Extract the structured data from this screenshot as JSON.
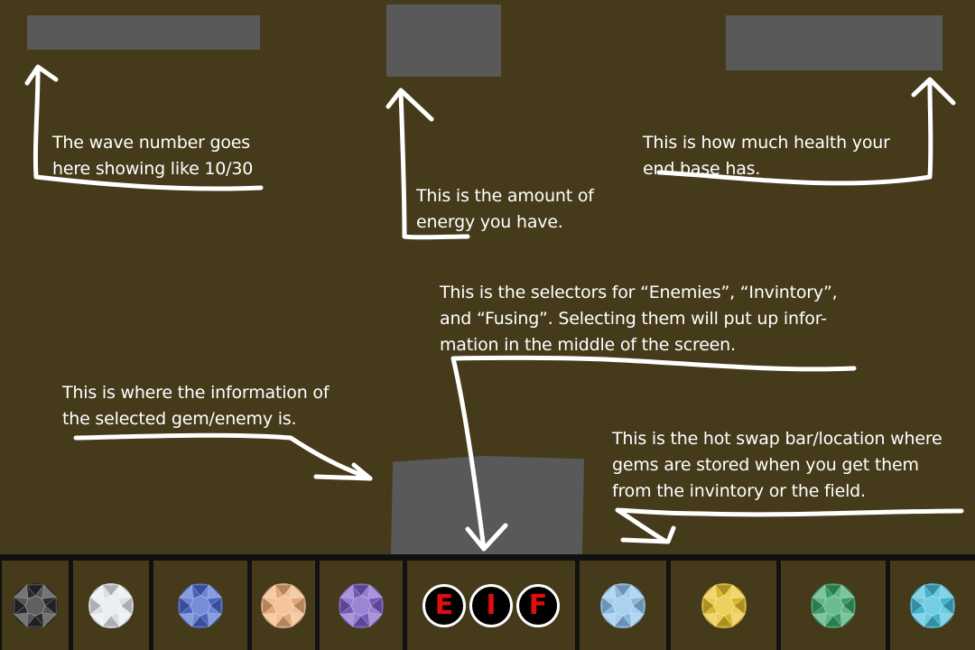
{
  "annotations": {
    "wave": "The wave number goes\nhere showing like 10/30",
    "energy": "This is the amount of\nenergy you have.",
    "health": "This is how much health your\nend base has.",
    "selectors": "This is the selectors for “Enemies”, “Invintory”,\nand “Fusing”. Selecting them will put up infor-\nmation in the middle of the screen.",
    "info": "This is where the information of\nthe selected gem/enemy is.",
    "hotswap": "This is the hot swap bar/location where\ngems are stored when you get them\nfrom the invintory or the field."
  },
  "hotbar": {
    "left_gems": [
      {
        "icon": "black-gem-icon",
        "color": "#2b2b2e"
      },
      {
        "icon": "white-gem-icon",
        "color": "#e6eaee"
      },
      {
        "icon": "blue-gem-icon",
        "color": "#4a68c8"
      },
      {
        "icon": "peach-gem-icon",
        "color": "#f0b07a"
      },
      {
        "icon": "purple-gem-icon",
        "color": "#7b5cc4"
      }
    ],
    "selectors": [
      {
        "label": "E",
        "icon": "enemies-selector"
      },
      {
        "label": "I",
        "icon": "inventory-selector"
      },
      {
        "label": "F",
        "icon": "fusing-selector"
      }
    ],
    "right_gems": [
      {
        "icon": "light-blue-gem-icon",
        "color": "#8ec2ea"
      },
      {
        "icon": "yellow-gem-icon",
        "color": "#e8c02a"
      },
      {
        "icon": "green-gem-icon",
        "color": "#3aa468"
      },
      {
        "icon": "cyan-gem-icon",
        "color": "#45bcd8"
      }
    ]
  },
  "colors": {
    "background": "#453b1b",
    "placeholder": "#595959",
    "selector_letter": "#e30d0d"
  }
}
